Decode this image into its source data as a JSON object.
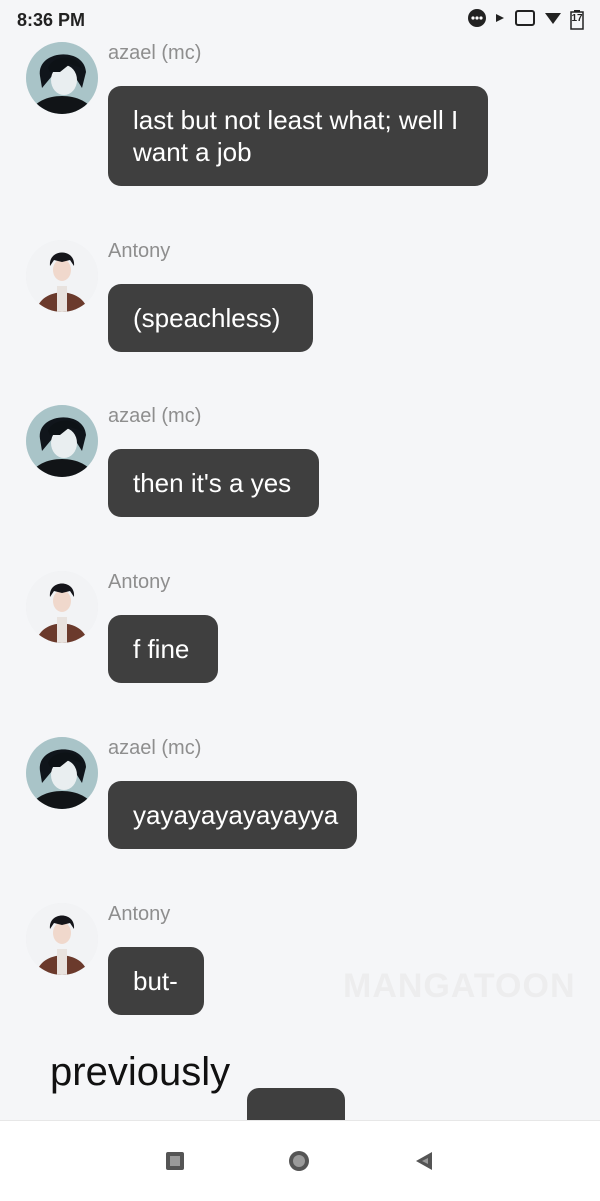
{
  "status_bar": {
    "time": "8:36 PM",
    "battery_level": "17",
    "icons": [
      "more-notifications-icon",
      "notification-icon",
      "screen-icon",
      "wifi-icon",
      "battery-icon"
    ]
  },
  "messages": [
    {
      "sender": "azael (mc)",
      "avatar": "azael-avatar",
      "text": "last but not least what; well I want a job"
    },
    {
      "sender": "Antony",
      "avatar": "antony-avatar",
      "text": "(speachless)"
    },
    {
      "sender": "azael (mc)",
      "avatar": "azael-avatar",
      "text": "then it's a yes"
    },
    {
      "sender": "Antony",
      "avatar": "antony-avatar",
      "text": "f fine"
    },
    {
      "sender": "azael (mc)",
      "avatar": "azael-avatar",
      "text": "yayayayayayayya"
    },
    {
      "sender": "Antony",
      "avatar": "antony-avatar",
      "text": "but-"
    }
  ],
  "watermark": "MANGATOON",
  "overlay_text": "previously",
  "navigation": {
    "buttons": [
      "recents-button",
      "home-button",
      "back-button"
    ]
  },
  "colors": {
    "background": "#f5f6f8",
    "bubble": "#3f3f3f",
    "bubble_text": "#ffffff",
    "sender_text": "#8e8e8e"
  }
}
